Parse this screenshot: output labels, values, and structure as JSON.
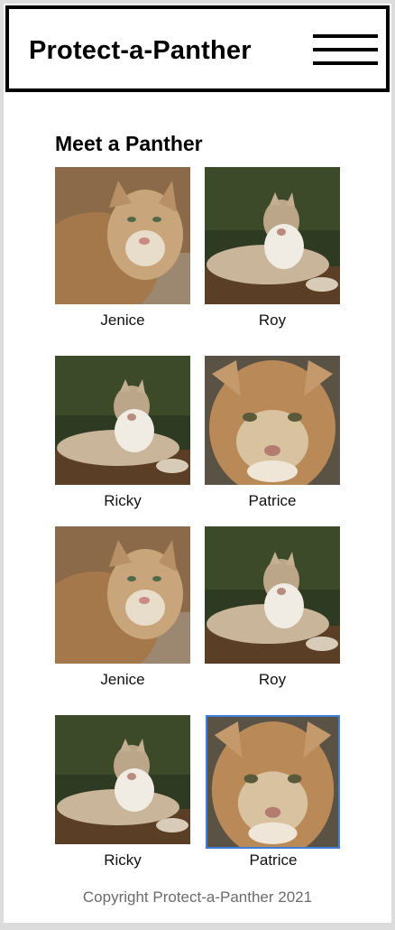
{
  "header": {
    "title": "Protect-a-Panther",
    "menu_icon": "hamburger-menu-icon"
  },
  "main": {
    "section_title": "Meet a Panther",
    "panthers": [
      {
        "name": "Jenice",
        "photo": "panther-closeup-photo"
      },
      {
        "name": "Roy",
        "photo": "panther-lying-photo"
      },
      {
        "name": "Ricky",
        "photo": "panther-lying-photo"
      },
      {
        "name": "Patrice",
        "photo": "panther-face-photo"
      },
      {
        "name": "Jenice",
        "photo": "panther-closeup-photo"
      },
      {
        "name": "Roy",
        "photo": "panther-lying-photo"
      },
      {
        "name": "Ricky",
        "photo": "panther-lying-photo"
      },
      {
        "name": "Patrice",
        "photo": "panther-face-photo",
        "selected": true
      }
    ]
  },
  "footer": {
    "copyright": "Copyright Protect-a-Panther 2021"
  },
  "colors": {
    "selected_border": "#3d7fd9",
    "footer_text": "#6b6b6b"
  }
}
